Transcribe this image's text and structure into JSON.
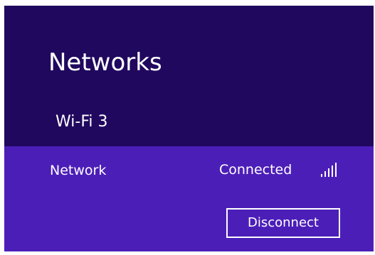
{
  "panel": {
    "title": "Networks",
    "connection_header": "Wi-Fi 3"
  },
  "network": {
    "name": "Network",
    "status": "Connected",
    "signal_icon": "wifi-signal-bars-icon",
    "signal_level_fraction": 1.0,
    "disconnect_label": "Disconnect"
  },
  "colors": {
    "panel_bg": "#20085f",
    "selected_item_bg": "#4c1eb8",
    "text": "#ffffff"
  }
}
